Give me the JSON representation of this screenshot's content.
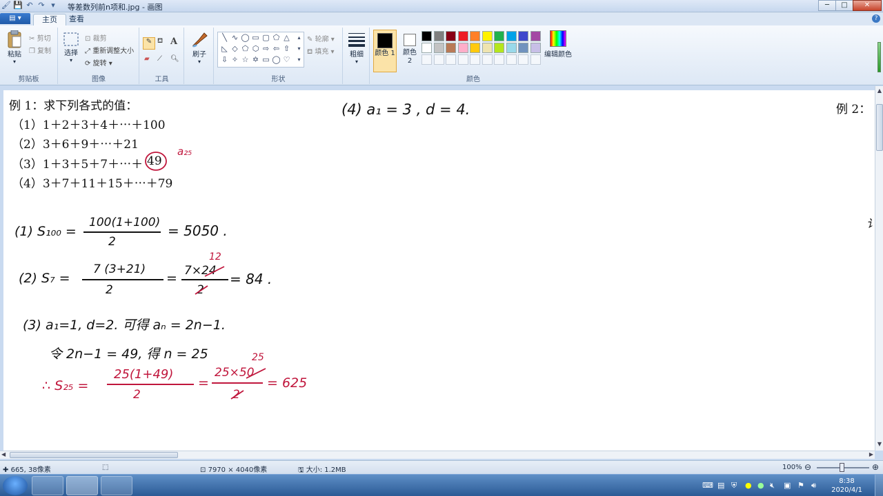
{
  "window": {
    "title": "等差数列前n项和.jpg - 画图",
    "minimize": "─",
    "maximize": "□",
    "close": "✕"
  },
  "tabs": {
    "app_menu": "▤ ▾",
    "home": "主页",
    "view": "查看",
    "help": "?"
  },
  "ribbon": {
    "clipboard": {
      "paste": "粘贴",
      "cut": "剪切",
      "copy": "复制",
      "label": "剪贴板"
    },
    "image": {
      "select": "选择",
      "crop": "裁剪",
      "resize": "重新调整大小",
      "rotate": "旋转",
      "label": "图像"
    },
    "tools": {
      "label": "工具",
      "text_tool": "A"
    },
    "brushes": {
      "label": "刷子"
    },
    "shapes": {
      "outline": "轮廓",
      "fill": "填充",
      "label": "形状"
    },
    "size": {
      "label": "粗细"
    },
    "colors": {
      "color1": "颜色 1",
      "color2": "颜色 2",
      "edit": "编辑颜色",
      "label": "颜色",
      "palette": [
        "#000000",
        "#7f7f7f",
        "#880015",
        "#ed1c24",
        "#ff7f27",
        "#fff200",
        "#22b14c",
        "#00a2e8",
        "#3f48cc",
        "#a349a4",
        "#ffffff",
        "#c3c3c3",
        "#b97a57",
        "#ffaec9",
        "#ffc90e",
        "#efe4b0",
        "#b5e61d",
        "#99d9ea",
        "#7092be",
        "#c8bfe7"
      ]
    }
  },
  "document": {
    "example1_title": "例 1：求下列各式的值：",
    "example1_items": [
      "（1）1＋2＋3＋4＋⋯＋100",
      "（2）3＋6＋9＋⋯＋21",
      "（3）1＋3＋5＋7＋⋯＋",
      "（4）3＋7＋11＋15＋⋯＋79"
    ],
    "circled_value": "49",
    "annotation_a25": "a₂₅",
    "example2_title": "例 2：",
    "hand_4": "(4) a₁ = 3 ,  d = 4.",
    "sol1_left": "(1) S₁₀₀ =",
    "sol1_num": "100(1+100)",
    "sol1_den": "2",
    "sol1_result": "= 5050 .",
    "sol2_left": "(2) S₇ =",
    "sol2_num": "7 (3+21)",
    "sol2_den": "2",
    "sol2_mid_num": "7×24",
    "sol2_mid_den": "2",
    "sol2_above": "12",
    "sol2_result": "= 84 .",
    "sol3_line1": "(3) a₁=1,  d=2.  可得 aₙ = 2n−1.",
    "sol3_line2": "令 2n−1 = 49,  得 n = 25",
    "sol3_left": "∴ S₂₅ =",
    "sol3_num": "25(1+49)",
    "sol3_den": "2",
    "sol3_mid_num": "25×50",
    "sol3_mid_den": "2",
    "sol3_above": "25",
    "sol3_result": "= 625",
    "edge_mark": "讠"
  },
  "status": {
    "cursor_pos": "665, 38像素",
    "image_size": "7970 × 4040像素",
    "file_size": "大小: 1.2MB",
    "zoom": "100%"
  },
  "taskbar": {
    "time": "8:38",
    "date": "2020/4/1"
  }
}
